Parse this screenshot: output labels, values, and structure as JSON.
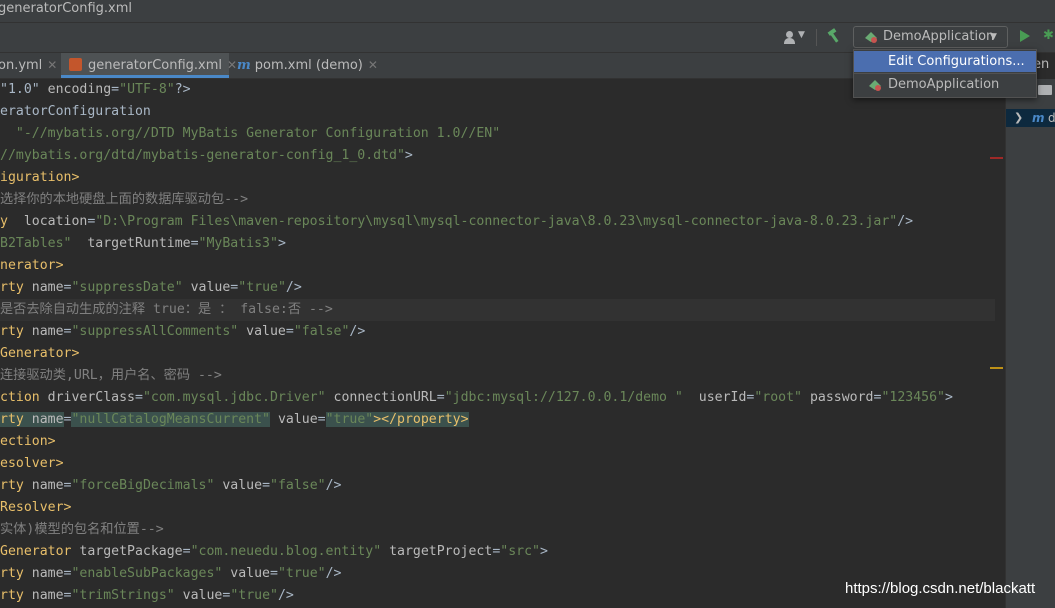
{
  "window": {
    "title": "generatorConfig.xml"
  },
  "toolbar": {
    "run_config": "DemoApplication"
  },
  "tabs": [
    {
      "label": "on.yml"
    },
    {
      "label": "generatorConfig.xml"
    },
    {
      "label": "pom.xml (demo)"
    }
  ],
  "dropdown": {
    "items": [
      "Edit Configurations...",
      "DemoApplication"
    ]
  },
  "right_panel": {
    "label_en": "en",
    "tree_item": "d"
  },
  "editor": {
    "lines": [
      [
        {
          "t": "plain",
          "s": "\"1.0\" "
        },
        {
          "t": "attr",
          "s": "encoding"
        },
        {
          "t": "plain",
          "s": "="
        },
        {
          "t": "val",
          "s": "\"UTF-8\""
        },
        {
          "t": "plain",
          "s": "?>"
        }
      ],
      [
        {
          "t": "plain",
          "s": "eratorConfiguration"
        }
      ],
      [
        {
          "t": "val",
          "s": "  \"-//mybatis.org//DTD MyBatis Generator Configuration 1.0//EN\""
        }
      ],
      [
        {
          "t": "val",
          "s": "//mybatis.org/dtd/mybatis-generator-config_1_0.dtd\""
        },
        {
          "t": "plain",
          "s": ">"
        }
      ],
      [
        {
          "t": "tag",
          "s": "iguration>"
        }
      ],
      [
        {
          "t": "com",
          "s": "选择你的本地硬盘上面的数据库驱动包-->"
        }
      ],
      [
        {
          "t": "tag",
          "s": "y  "
        },
        {
          "t": "attr",
          "s": "location"
        },
        {
          "t": "plain",
          "s": "="
        },
        {
          "t": "val",
          "s": "\"D:\\Program Files\\maven-repository\\mysql\\mysql-connector-java\\8.0.23\\mysql-connector-java-8.0.23.jar\""
        },
        {
          "t": "plain",
          "s": "/>"
        }
      ],
      [
        {
          "t": "val",
          "s": "B2Tables\""
        },
        {
          "t": "plain",
          "s": "  "
        },
        {
          "t": "attr",
          "s": "targetRuntime"
        },
        {
          "t": "plain",
          "s": "="
        },
        {
          "t": "val",
          "s": "\"MyBatis3\""
        },
        {
          "t": "plain",
          "s": ">"
        }
      ],
      [
        {
          "t": "tag",
          "s": "nerator>"
        }
      ],
      [
        {
          "t": "tag",
          "s": "rty "
        },
        {
          "t": "attr",
          "s": "name"
        },
        {
          "t": "plain",
          "s": "="
        },
        {
          "t": "val",
          "s": "\"suppressDate\""
        },
        {
          "t": "plain",
          "s": " "
        },
        {
          "t": "attr",
          "s": "value"
        },
        {
          "t": "plain",
          "s": "="
        },
        {
          "t": "val",
          "s": "\"true\""
        },
        {
          "t": "plain",
          "s": "/>"
        }
      ],
      [
        {
          "t": "com",
          "s": "是否去除自动生成的注释 true：是 ： false:否 -->"
        }
      ],
      [
        {
          "t": "tag",
          "s": "rty "
        },
        {
          "t": "attr",
          "s": "name"
        },
        {
          "t": "plain",
          "s": "="
        },
        {
          "t": "val",
          "s": "\"suppressAllComments\""
        },
        {
          "t": "plain",
          "s": " "
        },
        {
          "t": "attr",
          "s": "value"
        },
        {
          "t": "plain",
          "s": "="
        },
        {
          "t": "val",
          "s": "\"false\""
        },
        {
          "t": "plain",
          "s": "/>"
        }
      ],
      [
        {
          "t": "tag",
          "s": "Generator>"
        }
      ],
      [
        {
          "t": "com",
          "s": "连接驱动类,URL，用户名、密码 -->"
        }
      ],
      [
        {
          "t": "tag",
          "s": "ction "
        },
        {
          "t": "attr",
          "s": "driverClass"
        },
        {
          "t": "plain",
          "s": "="
        },
        {
          "t": "val",
          "s": "\"com.mysql.jdbc.Driver\""
        },
        {
          "t": "plain",
          "s": " "
        },
        {
          "t": "attr",
          "s": "connectionURL"
        },
        {
          "t": "plain",
          "s": "="
        },
        {
          "t": "val",
          "s": "\"jdbc:mysql://127.0.0.1/demo \""
        },
        {
          "t": "plain",
          "s": "  "
        },
        {
          "t": "attr",
          "s": "userId"
        },
        {
          "t": "plain",
          "s": "="
        },
        {
          "t": "val",
          "s": "\"root\""
        },
        {
          "t": "plain",
          "s": " "
        },
        {
          "t": "attr",
          "s": "password"
        },
        {
          "t": "plain",
          "s": "="
        },
        {
          "t": "val",
          "s": "\"123456\""
        },
        {
          "t": "plain",
          "s": ">"
        }
      ],
      [
        {
          "t": "tagsel",
          "s": "rty "
        },
        {
          "t": "attrsel",
          "s": "name"
        },
        {
          "t": "plain",
          "s": "="
        },
        {
          "t": "valsel",
          "s": "\"nullCatalogMeansCurrent\""
        },
        {
          "t": "plain",
          "s": " "
        },
        {
          "t": "attr",
          "s": "value"
        },
        {
          "t": "plain",
          "s": "="
        },
        {
          "t": "valsel",
          "s": "\"true\""
        },
        {
          "t": "tagsel",
          "s": "></property>"
        }
      ],
      [
        {
          "t": "tag",
          "s": "ection>"
        }
      ],
      [
        {
          "t": "tag",
          "s": "esolver>"
        }
      ],
      [
        {
          "t": "tag",
          "s": "rty "
        },
        {
          "t": "attr",
          "s": "name"
        },
        {
          "t": "plain",
          "s": "="
        },
        {
          "t": "val",
          "s": "\"forceBigDecimals\""
        },
        {
          "t": "plain",
          "s": " "
        },
        {
          "t": "attr",
          "s": "value"
        },
        {
          "t": "plain",
          "s": "="
        },
        {
          "t": "val",
          "s": "\"false\""
        },
        {
          "t": "plain",
          "s": "/>"
        }
      ],
      [
        {
          "t": "tag",
          "s": "Resolver>"
        }
      ],
      [
        {
          "t": "com",
          "s": "实体)模型的包名和位置-->"
        }
      ],
      [
        {
          "t": "tag",
          "s": "Generator "
        },
        {
          "t": "attr",
          "s": "targetPackage"
        },
        {
          "t": "plain",
          "s": "="
        },
        {
          "t": "val",
          "s": "\"com.neuedu.blog.entity\""
        },
        {
          "t": "plain",
          "s": " "
        },
        {
          "t": "attr",
          "s": "targetProject"
        },
        {
          "t": "plain",
          "s": "="
        },
        {
          "t": "val",
          "s": "\"src\""
        },
        {
          "t": "plain",
          "s": ">"
        }
      ],
      [
        {
          "t": "tag",
          "s": "rty "
        },
        {
          "t": "attr",
          "s": "name"
        },
        {
          "t": "plain",
          "s": "="
        },
        {
          "t": "val",
          "s": "\"enableSubPackages\""
        },
        {
          "t": "plain",
          "s": " "
        },
        {
          "t": "attr",
          "s": "value"
        },
        {
          "t": "plain",
          "s": "="
        },
        {
          "t": "val",
          "s": "\"true\""
        },
        {
          "t": "plain",
          "s": "/>"
        }
      ],
      [
        {
          "t": "tag",
          "s": "rty "
        },
        {
          "t": "attr",
          "s": "name"
        },
        {
          "t": "plain",
          "s": "="
        },
        {
          "t": "val",
          "s": "\"trimStrings\""
        },
        {
          "t": "plain",
          "s": " "
        },
        {
          "t": "attr",
          "s": "value"
        },
        {
          "t": "plain",
          "s": "="
        },
        {
          "t": "val",
          "s": "\"true\""
        },
        {
          "t": "plain",
          "s": "/>"
        }
      ]
    ],
    "highlighted_lines": [
      10
    ]
  },
  "watermark": "https://blog.csdn.net/blackatt",
  "colors": {
    "accent": "#4b6eaf",
    "run_green": "#499c54",
    "xml_tag": "#e8bf6a",
    "xml_value": "#6a8759"
  }
}
